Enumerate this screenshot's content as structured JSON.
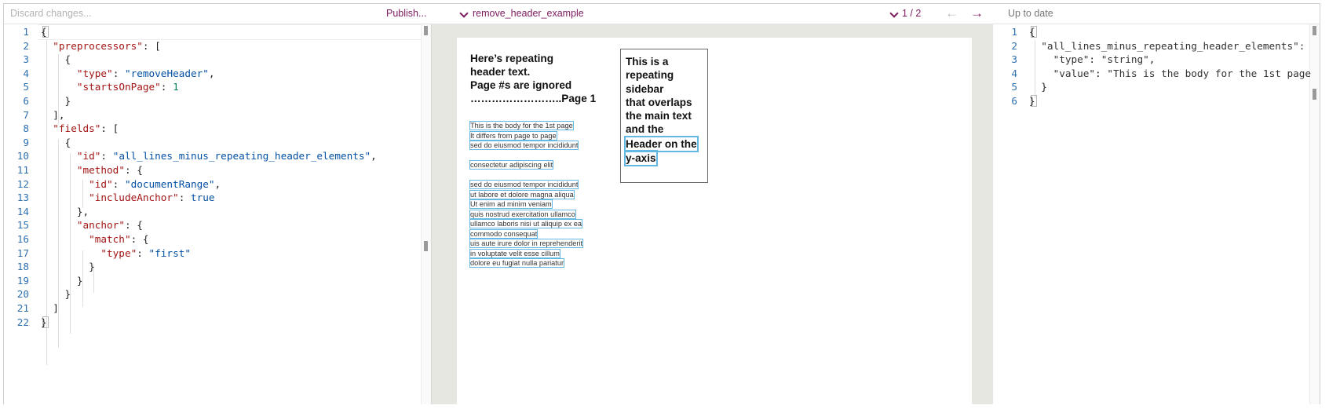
{
  "toolbar": {
    "discard_label": "Discard changes...",
    "publish_label": "Publish...",
    "document_name": "remove_header_example",
    "page_indicator": "1 / 2",
    "prev_icon": "arrow-left-icon",
    "next_icon": "arrow-right-icon",
    "status": "Up to date"
  },
  "config_editor": {
    "line_numbers": [
      "1",
      "2",
      "3",
      "4",
      "5",
      "6",
      "7",
      "8",
      "9",
      "10",
      "11",
      "12",
      "13",
      "14",
      "15",
      "16",
      "17",
      "18",
      "19",
      "20",
      "21",
      "22"
    ],
    "lines": [
      [
        {
          "t": "{",
          "c": "p"
        }
      ],
      [
        {
          "t": "  ",
          "c": "p"
        },
        {
          "t": "\"preprocessors\"",
          "c": "k"
        },
        {
          "t": ": [",
          "c": "p"
        }
      ],
      [
        {
          "t": "    {",
          "c": "p"
        }
      ],
      [
        {
          "t": "      ",
          "c": "p"
        },
        {
          "t": "\"type\"",
          "c": "k"
        },
        {
          "t": ": ",
          "c": "p"
        },
        {
          "t": "\"removeHeader\"",
          "c": "s"
        },
        {
          "t": ",",
          "c": "p"
        }
      ],
      [
        {
          "t": "      ",
          "c": "p"
        },
        {
          "t": "\"startsOnPage\"",
          "c": "k"
        },
        {
          "t": ": ",
          "c": "p"
        },
        {
          "t": "1",
          "c": "n"
        }
      ],
      [
        {
          "t": "    }",
          "c": "p"
        }
      ],
      [
        {
          "t": "  ],",
          "c": "p"
        }
      ],
      [
        {
          "t": "  ",
          "c": "p"
        },
        {
          "t": "\"fields\"",
          "c": "k"
        },
        {
          "t": ": [",
          "c": "p"
        }
      ],
      [
        {
          "t": "    {",
          "c": "p"
        }
      ],
      [
        {
          "t": "      ",
          "c": "p"
        },
        {
          "t": "\"id\"",
          "c": "k"
        },
        {
          "t": ": ",
          "c": "p"
        },
        {
          "t": "\"all_lines_minus_repeating_header_elements\"",
          "c": "s"
        },
        {
          "t": ",",
          "c": "p"
        }
      ],
      [
        {
          "t": "      ",
          "c": "p"
        },
        {
          "t": "\"method\"",
          "c": "k"
        },
        {
          "t": ": {",
          "c": "p"
        }
      ],
      [
        {
          "t": "        ",
          "c": "p"
        },
        {
          "t": "\"id\"",
          "c": "k"
        },
        {
          "t": ": ",
          "c": "p"
        },
        {
          "t": "\"documentRange\"",
          "c": "s"
        },
        {
          "t": ",",
          "c": "p"
        }
      ],
      [
        {
          "t": "        ",
          "c": "p"
        },
        {
          "t": "\"includeAnchor\"",
          "c": "k"
        },
        {
          "t": ": ",
          "c": "p"
        },
        {
          "t": "true",
          "c": "b"
        }
      ],
      [
        {
          "t": "      },",
          "c": "p"
        }
      ],
      [
        {
          "t": "      ",
          "c": "p"
        },
        {
          "t": "\"anchor\"",
          "c": "k"
        },
        {
          "t": ": {",
          "c": "p"
        }
      ],
      [
        {
          "t": "        ",
          "c": "p"
        },
        {
          "t": "\"match\"",
          "c": "k"
        },
        {
          "t": ": {",
          "c": "p"
        }
      ],
      [
        {
          "t": "          ",
          "c": "p"
        },
        {
          "t": "\"type\"",
          "c": "k"
        },
        {
          "t": ": ",
          "c": "p"
        },
        {
          "t": "\"first\"",
          "c": "s"
        }
      ],
      [
        {
          "t": "        }",
          "c": "p"
        }
      ],
      [
        {
          "t": "      }",
          "c": "p"
        }
      ],
      [
        {
          "t": "    }",
          "c": "p"
        }
      ],
      [
        {
          "t": "  ]",
          "c": "p"
        }
      ],
      [
        {
          "t": "}",
          "c": "p"
        }
      ]
    ]
  },
  "document_view": {
    "header_lines": [
      "Here’s repeating",
      "header text.",
      "Page #s are ignored",
      "……………………..Page 1"
    ],
    "sidebar_lines": [
      "This is a",
      "repeating",
      "sidebar",
      "that overlaps",
      "the main text",
      "and the",
      "Header on the",
      "y-axis"
    ],
    "body_lines": [
      "This is the body for the 1st page",
      "It differs from page to page",
      "sed do eiusmod tempor incididunt",
      "consectetur adipiscing elit",
      "sed do eiusmod tempor incididunt",
      "ut labore et dolore magna aliqua",
      "Ut enim ad minim veniam",
      "quis nostrud exercitation ullamco",
      "ullamco laboris nisi ut aliquip ex ea",
      "commodo consequat",
      "uis aute irure dolor in reprehenderit",
      "in voluptate velit esse cillum",
      "dolore eu fugiat nulla pariatur"
    ]
  },
  "output_editor": {
    "line_numbers": [
      "1",
      "2",
      "3",
      "4",
      "5",
      "6"
    ],
    "lines": [
      [
        {
          "t": "{",
          "c": "p"
        }
      ],
      [
        {
          "t": "  ",
          "c": "p"
        },
        {
          "t": "\"all_lines_minus_repeating_header_elements\":",
          "c": "k"
        }
      ],
      [
        {
          "t": "    ",
          "c": "p"
        },
        {
          "t": "\"type\"",
          "c": "k"
        },
        {
          "t": ": ",
          "c": "p"
        },
        {
          "t": "\"string\"",
          "c": "s"
        },
        {
          "t": ",",
          "c": "p"
        }
      ],
      [
        {
          "t": "    ",
          "c": "p"
        },
        {
          "t": "\"value\"",
          "c": "k"
        },
        {
          "t": ": ",
          "c": "p"
        },
        {
          "t": "\"This is the body for the 1st page",
          "c": "s"
        }
      ],
      [
        {
          "t": "  }",
          "c": "p"
        }
      ],
      [
        {
          "t": "}",
          "c": "p"
        }
      ]
    ]
  },
  "colors": {
    "accent": "#7d1a5e",
    "line_number": "#2f70b0",
    "json_key": "#a31515",
    "json_string": "#0451a5",
    "json_number": "#098658",
    "highlight_box": "#62b8e0"
  }
}
